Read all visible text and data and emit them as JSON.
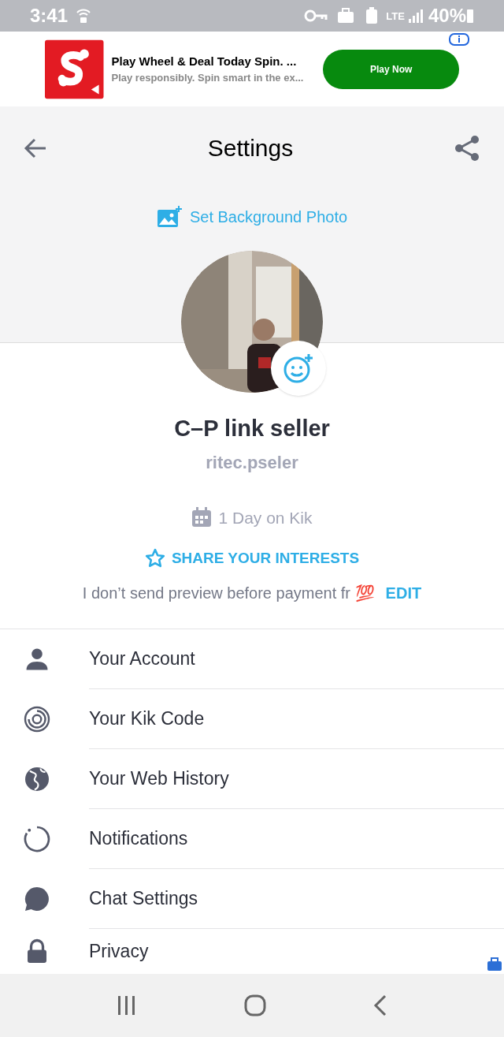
{
  "status_bar": {
    "time": "3:41",
    "network": "LTE",
    "battery": "40%"
  },
  "ad": {
    "title": "Play Wheel & Deal Today Spin. ...",
    "subtitle": "Play responsibly. Spin smart in the ex...",
    "button": "Play Now"
  },
  "header": {
    "title": "Settings"
  },
  "background_link": "Set Background Photo",
  "profile": {
    "display_name": "C–P link seller",
    "username": "ritec.pseler",
    "joined": "1 Day on Kik",
    "interests_link": "SHARE YOUR INTERESTS",
    "bio": "I don’t send preview before payment fr 💯",
    "edit": "EDIT"
  },
  "menu": [
    {
      "kind": "account",
      "label": "Your Account"
    },
    {
      "kind": "kik_code",
      "label": "Your Kik Code"
    },
    {
      "kind": "web_history",
      "label": "Your Web History"
    },
    {
      "kind": "notifications",
      "label": "Notifications"
    },
    {
      "kind": "chat_settings",
      "label": "Chat Settings"
    },
    {
      "kind": "privacy",
      "label": "Privacy"
    }
  ]
}
